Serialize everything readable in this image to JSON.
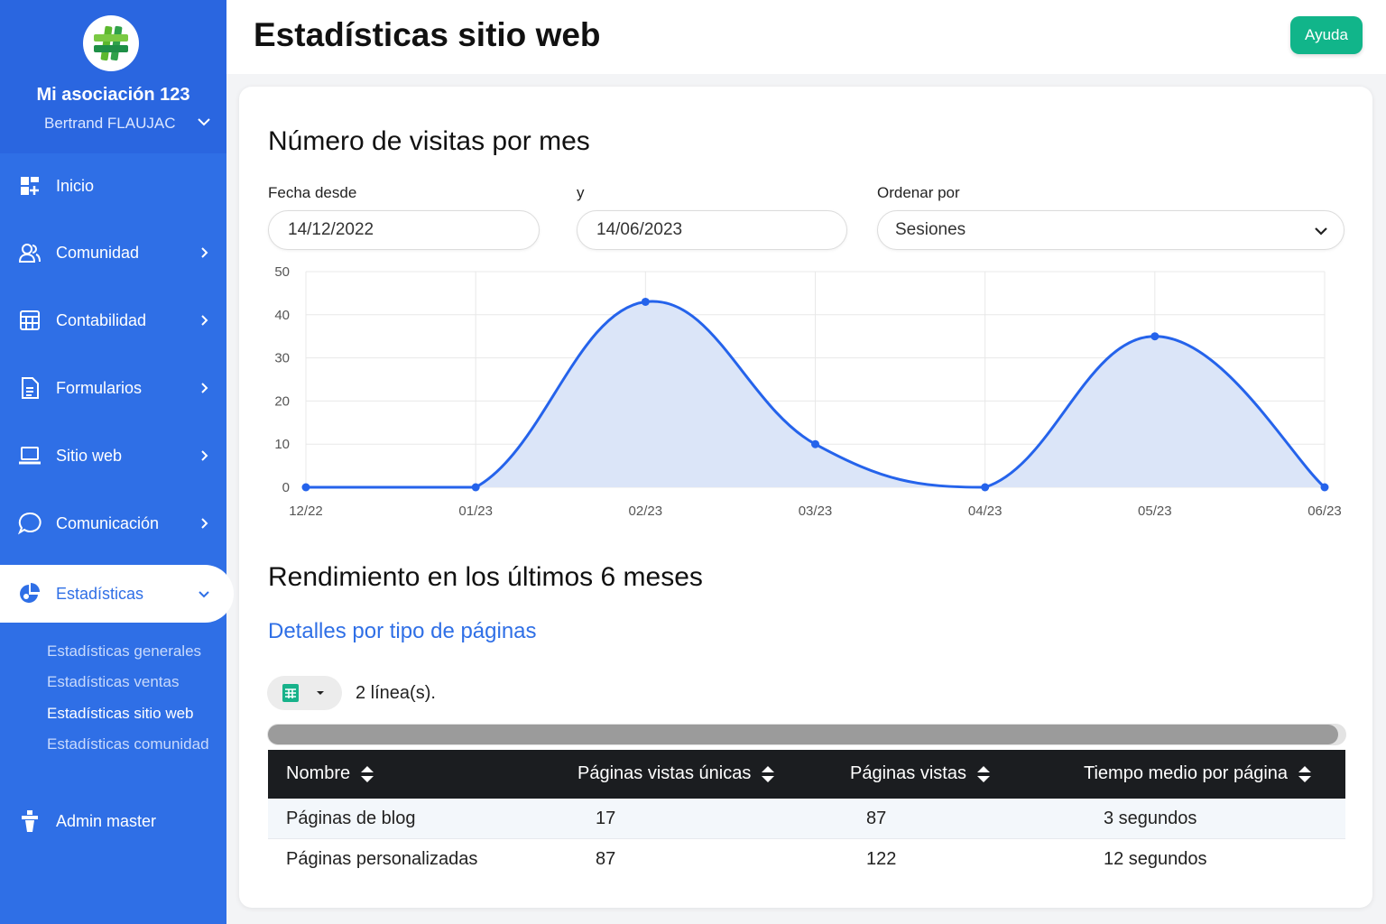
{
  "sidebar": {
    "org_name": "Mi asociación 123",
    "user_name": "Bertrand FLAUJAC",
    "items": [
      {
        "label": "Inicio",
        "icon": "dashboard-icon"
      },
      {
        "label": "Comunidad",
        "icon": "users-icon"
      },
      {
        "label": "Contabilidad",
        "icon": "calculator-icon"
      },
      {
        "label": "Formularios",
        "icon": "document-icon"
      },
      {
        "label": "Sitio web",
        "icon": "laptop-icon"
      },
      {
        "label": "Comunicación",
        "icon": "chat-icon"
      },
      {
        "label": "Estadísticas",
        "icon": "pie-chart-icon"
      }
    ],
    "sub_items": [
      "Estadísticas generales",
      "Estadísticas ventas",
      "Estadísticas sitio web",
      "Estadísticas comunidad"
    ],
    "admin_label": "Admin master"
  },
  "header": {
    "title": "Estadísticas sitio web",
    "help_label": "Ayuda"
  },
  "visits": {
    "title": "Número de visitas por mes",
    "from_label": "Fecha desde",
    "from_value": "14/12/2022",
    "to_label": "y",
    "to_value": "14/06/2023",
    "sort_label": "Ordenar por",
    "sort_value": "Sesiones"
  },
  "chart_data": {
    "type": "area",
    "x": [
      "12/22",
      "01/23",
      "02/23",
      "03/23",
      "04/23",
      "05/23",
      "06/23"
    ],
    "y_ticks": [
      0,
      10,
      20,
      30,
      40,
      50
    ],
    "ylim": [
      0,
      50
    ],
    "series": [
      {
        "values": [
          0,
          0,
          43,
          10,
          0,
          35,
          0
        ]
      }
    ],
    "colors": {
      "line": "#2563eb",
      "fill": "#dbe5f8",
      "grid": "#e8e8e8"
    }
  },
  "performance": {
    "title": "Rendimiento en los últimos 6 meses",
    "link": "Detalles por tipo de páginas",
    "rows_count": "2 línea(s).",
    "columns": [
      "Nombre",
      "Páginas vistas únicas",
      "Páginas vistas",
      "Tiempo medio por página"
    ],
    "rows": [
      [
        "Páginas de blog",
        "17",
        "87",
        "3 segundos"
      ],
      [
        "Páginas personalizadas",
        "87",
        "122",
        "12 segundos"
      ]
    ]
  }
}
